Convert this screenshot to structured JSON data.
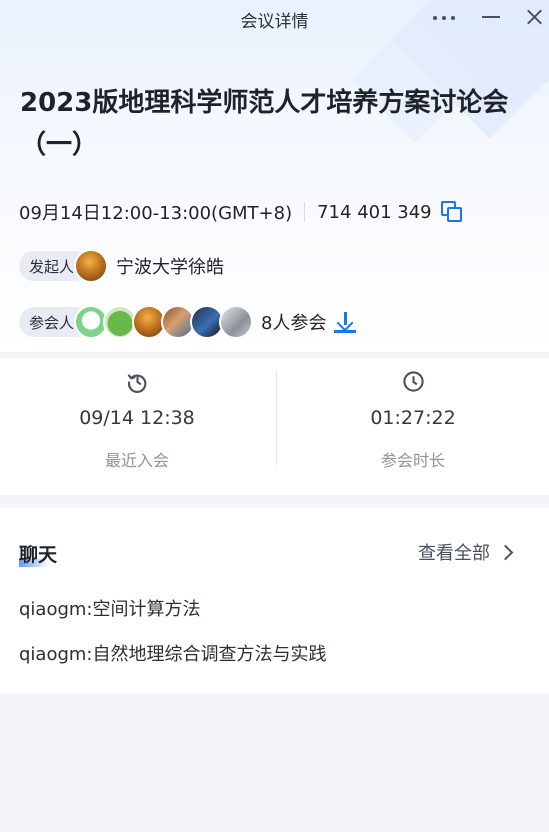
{
  "window": {
    "title": "会议详情"
  },
  "meeting": {
    "title_line1": "2023版地理科学师范人才培养方案讨论会",
    "title_line2": "（一）",
    "datetime": "09月14日12:00-13:00(GMT+8)",
    "meeting_id": "714 401 349"
  },
  "host": {
    "label": "发起人",
    "name": "宁波大学徐皓"
  },
  "participants": {
    "label": "参会人",
    "count_text": "8人参会"
  },
  "stats": {
    "recent_join_value": "09/14 12:38",
    "recent_join_label": "最近入会",
    "duration_value": "01:27:22",
    "duration_label": "参会时长"
  },
  "chat": {
    "title": "聊天",
    "view_all": "查看全部",
    "messages": [
      {
        "sender": "qiaogm:",
        "text": "空间计算方法"
      },
      {
        "sender": "qiaogm:",
        "text": "自然地理综合调查方法与实践"
      }
    ]
  },
  "colors": {
    "accent": "#1b74f5",
    "background": "#f3f5f9",
    "card": "#ffffff"
  },
  "icons": [
    "more-icon",
    "minimize-icon",
    "close-icon",
    "copy-icon",
    "download-icon",
    "history-clock-icon",
    "clock-icon",
    "chevron-right-icon"
  ]
}
